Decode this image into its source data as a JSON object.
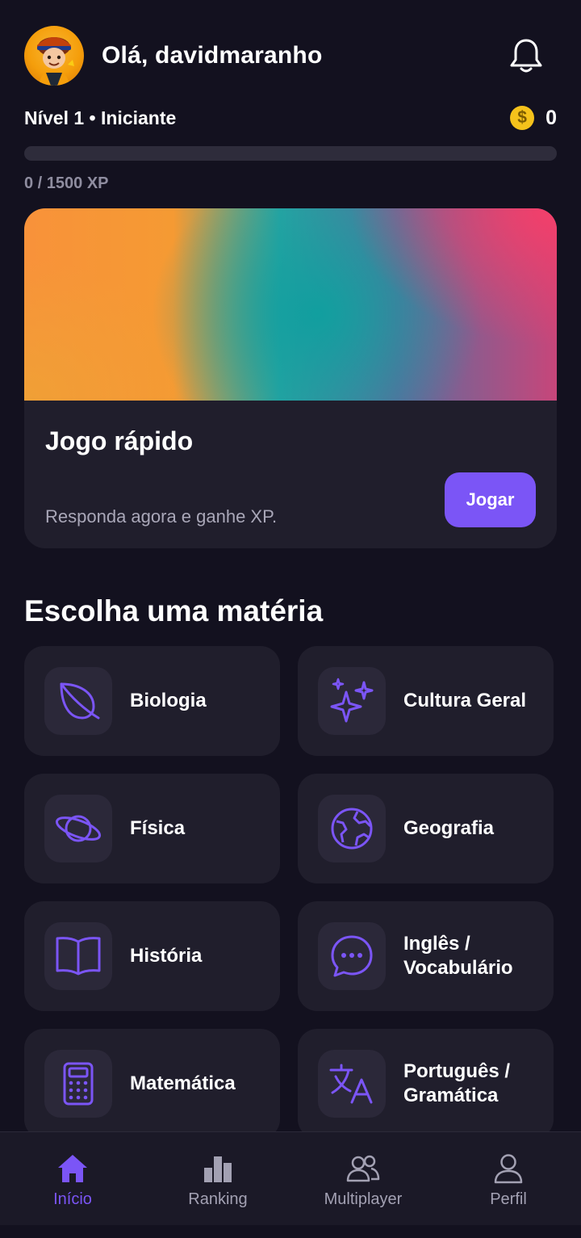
{
  "header": {
    "greeting": "Olá, davidmaranho",
    "avatar_icon": "avatar-image",
    "notifications_icon": "bell-icon"
  },
  "level": {
    "label": "Nível 1 • Iniciante",
    "coins": "0",
    "coin_symbol": "$",
    "xp_text": "0 / 1500 XP",
    "xp_progress": 0
  },
  "quick_play": {
    "title": "Jogo rápido",
    "subtitle": "Responda agora e ganhe XP.",
    "button": "Jogar"
  },
  "subjects_section": {
    "title": "Escolha uma matéria",
    "items": [
      {
        "label": "Biologia",
        "icon": "leaf-icon"
      },
      {
        "label": "Cultura Geral",
        "icon": "sparkles-icon"
      },
      {
        "label": "Física",
        "icon": "planet-icon"
      },
      {
        "label": "Geografia",
        "icon": "globe-icon"
      },
      {
        "label": "História",
        "icon": "book-icon"
      },
      {
        "label": "Inglês /\nVocabulário",
        "icon": "chat-icon"
      },
      {
        "label": "Matemática",
        "icon": "calculator-icon"
      },
      {
        "label": "Português /\nGramática",
        "icon": "translate-icon"
      }
    ]
  },
  "nav": {
    "items": [
      {
        "label": "Início",
        "icon": "home-icon",
        "active": true
      },
      {
        "label": "Ranking",
        "icon": "bar-chart-icon",
        "active": false
      },
      {
        "label": "Multiplayer",
        "icon": "users-icon",
        "active": false
      },
      {
        "label": "Perfil",
        "icon": "user-icon",
        "active": false
      }
    ]
  },
  "colors": {
    "background": "#13111f",
    "card": "#201e2c",
    "accent": "#7b55f6",
    "coin": "#f5c21b"
  }
}
